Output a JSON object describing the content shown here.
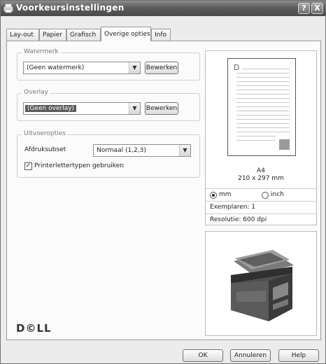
{
  "window": {
    "title": "Voorkeursinstellingen",
    "help_glyph": "?",
    "close_glyph": "X"
  },
  "tabs": [
    {
      "label": "Lay-out",
      "active": false
    },
    {
      "label": "Papier",
      "active": false
    },
    {
      "label": "Grafisch",
      "active": false
    },
    {
      "label": "Overige opties",
      "active": true
    },
    {
      "label": "Info",
      "active": false
    }
  ],
  "watermark": {
    "legend": "Watermerk",
    "selected": "(Geen watermerk)",
    "edit_label": "Bewerken"
  },
  "overlay": {
    "legend": "Overlay",
    "selected": "(Geen overlay)",
    "edit_label": "Bewerken"
  },
  "output": {
    "legend": "Uitvoeropties",
    "subset_label": "Afdruksubset",
    "subset_value": "Normaal (1,2,3)",
    "printer_fonts_label": "Printerlettertypen gebruiken",
    "printer_fonts_checked": true
  },
  "preview": {
    "paper_name": "A4",
    "paper_size": "210 x 297 mm",
    "unit_mm": "mm",
    "unit_inch": "inch",
    "unit_selected": "mm",
    "copies": "Exemplaren: 1",
    "resolution": "Resolutie: 600 dpi"
  },
  "brand": "D©LL",
  "buttons": {
    "ok": "OK",
    "cancel": "Annuleren",
    "help": "Help"
  },
  "colors": {
    "titlebar": "#5c5c5c",
    "selection": "#5a5a5a"
  }
}
